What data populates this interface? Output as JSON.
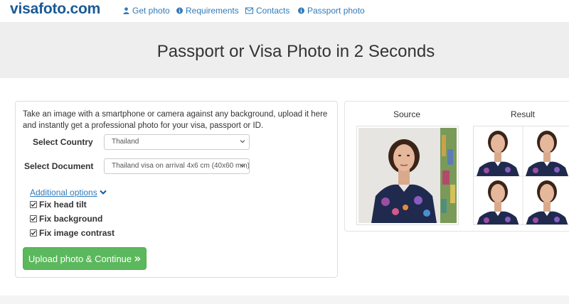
{
  "brand": {
    "logo_text": "visafoto.com"
  },
  "nav": {
    "items": [
      {
        "label": "Get photo",
        "icon": "user-icon"
      },
      {
        "label": "Requirements",
        "icon": "info-icon"
      },
      {
        "label": "Contacts",
        "icon": "envelope-icon"
      },
      {
        "label": "Passport photo",
        "icon": "info-icon"
      }
    ]
  },
  "hero": {
    "title": "Passport or Visa Photo in 2 Seconds"
  },
  "form": {
    "intro": "Take an image with a smartphone or camera against any background, upload it here and instantly get a professional photo for your visa, passport or ID.",
    "country_label": "Select Country",
    "country_value": "Thailand",
    "document_label": "Select Document",
    "document_value": "Thailand visa on arrival 4x6 cm (40x60 mm)",
    "additional_options": "Additional options",
    "options": [
      {
        "label": "Fix head tilt",
        "checked": true
      },
      {
        "label": "Fix background",
        "checked": true
      },
      {
        "label": "Fix image contrast",
        "checked": true
      }
    ],
    "upload_label": "Upload photo & Continue",
    "upload_icon": "double-chevron-right-icon"
  },
  "preview": {
    "source_label": "Source",
    "result_label": "Result"
  },
  "colors": {
    "brand": "#1a5a96",
    "link": "#337ab7",
    "hero_bg": "#eeeeee",
    "button_green": "#5cb85c"
  }
}
